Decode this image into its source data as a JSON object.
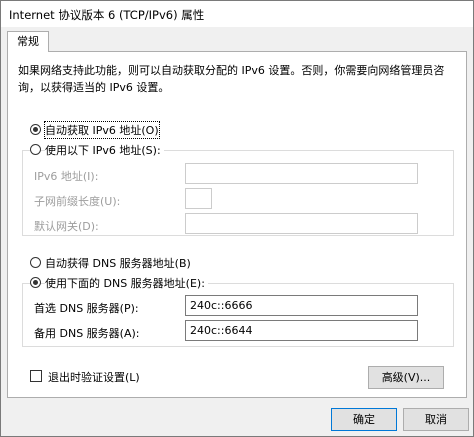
{
  "window": {
    "title": "Internet 协议版本 6 (TCP/IPv6) 属性"
  },
  "tabs": [
    {
      "label": "常规"
    }
  ],
  "description": "如果网络支持此功能，则可以自动获取分配的 IPv6 设置。否则，你需要向网络管理员咨询，以获得适当的 IPv6 设置。",
  "ip_mode": {
    "auto_label": "自动获取 IPv6 地址(O)",
    "manual_label": "使用以下 IPv6 地址(S):",
    "selected": "auto"
  },
  "ip_fields": {
    "ipv6_label": "IPv6 地址(I):",
    "ipv6_value": "",
    "prefix_label": "子网前缀长度(U):",
    "prefix_value": "",
    "gateway_label": "默认网关(D):",
    "gateway_value": ""
  },
  "dns_mode": {
    "auto_label": "自动获得 DNS 服务器地址(B)",
    "manual_label": "使用下面的 DNS 服务器地址(E):",
    "selected": "manual"
  },
  "dns_fields": {
    "preferred_label": "首选 DNS 服务器(P):",
    "preferred_value": "240c::6666",
    "alternate_label": "备用 DNS 服务器(A):",
    "alternate_value": "240c::6644"
  },
  "validate": {
    "label": "退出时验证设置(L)",
    "checked": false
  },
  "buttons": {
    "advanced": "高级(V)...",
    "ok": "确定",
    "cancel": "取消"
  }
}
